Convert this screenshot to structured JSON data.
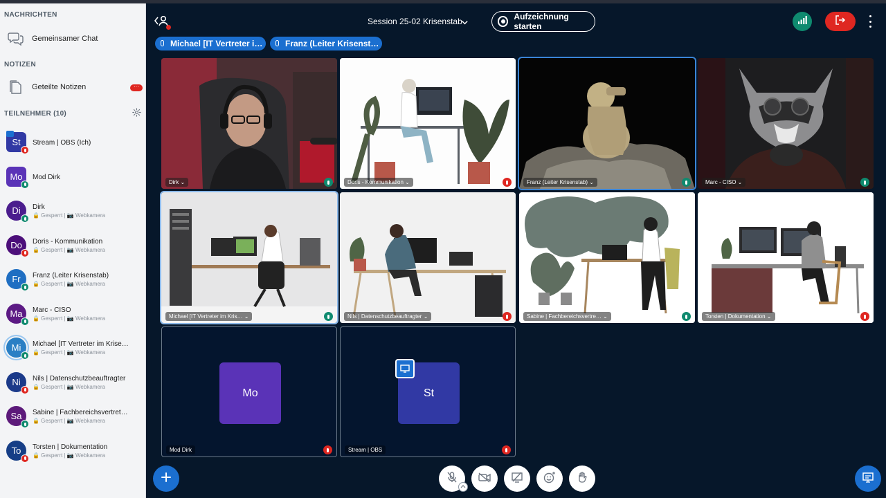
{
  "sidebar": {
    "messages_title": "NACHRICHTEN",
    "chat_label": "Gemeinsamer Chat",
    "notes_title": "NOTIZEN",
    "notes_label": "Geteilte Notizen",
    "notes_badge": "···",
    "participants_title": "TEILNEHMER (10)",
    "participants": [
      {
        "initials": "St",
        "name": "Stream | OBS (Ich)",
        "sub": "",
        "color": "#3139a4",
        "mic": "red"
      },
      {
        "initials": "Mo",
        "name": "Mod Dirk",
        "sub": "",
        "color": "#5a33b7",
        "mic": "green"
      },
      {
        "initials": "Di",
        "name": "Dirk",
        "sub": "🔒 Gesperrt | 📷 Webkamera",
        "color": "#4b1d8e",
        "mic": "green"
      },
      {
        "initials": "Do",
        "name": "Doris - Kommunikation",
        "sub": "🔒 Gesperrt | 📷 Webkamera",
        "color": "#4c0f7a",
        "mic": "red"
      },
      {
        "initials": "Fr",
        "name": "Franz (Leiter Krisenstab)",
        "sub": "🔒 Gesperrt | 📷 Webkamera",
        "color": "#1f6ec2",
        "mic": "green"
      },
      {
        "initials": "Ma",
        "name": "Marc - CISO",
        "sub": "🔒 Gesperrt | 📷 Webkamera",
        "color": "#5c1a84",
        "mic": "green"
      },
      {
        "initials": "Mi",
        "name": "Michael [IT Vertreter im Krise…",
        "sub": "🔒 Gesperrt | 📷 Webkamera",
        "color": "#2a7fc4",
        "mic": "green"
      },
      {
        "initials": "Ni",
        "name": "Nils | Datenschutzbeauftragter",
        "sub": "🔒 Gesperrt | 📷 Webkamera",
        "color": "#1b3a8a",
        "mic": "red"
      },
      {
        "initials": "Sa",
        "name": "Sabine | Fachbereichsvertret…",
        "sub": "🔒 Gesperrt | 📷 Webkamera",
        "color": "#5c1a7a",
        "mic": "green"
      },
      {
        "initials": "To",
        "name": "Torsten | Dokumentation",
        "sub": "🔒 Gesperrt | 📷 Webkamera",
        "color": "#163e86",
        "mic": "red"
      }
    ]
  },
  "header": {
    "session_title": "Session 25-02 Krisenstab",
    "record_label": "Aufzeichnung starten",
    "talkers": [
      "Michael [IT Vertreter i…",
      "Franz (Leiter Krisenst…"
    ]
  },
  "tiles": [
    {
      "name": "Dirk ⌄",
      "mic": "green"
    },
    {
      "name": "Doris - Kommunikation ⌄",
      "mic": "red"
    },
    {
      "name": "Franz (Leiter Krisenstab) ⌄",
      "mic": "green"
    },
    {
      "name": "Marc - CISO ⌄",
      "mic": "green"
    },
    {
      "name": "Michael [IT Vertreter im Kris… ⌄",
      "mic": "green"
    },
    {
      "name": "Nils | Datenschutzbeauftragter ⌄",
      "mic": "red"
    },
    {
      "name": "Sabine | Fachbereichsvertre… ⌄",
      "mic": "green"
    },
    {
      "name": "Torsten | Dokumentation ⌄",
      "mic": "red"
    },
    {
      "name": "Mod Dirk",
      "mic": "red",
      "initials": "Mo",
      "color": "#5a33b7"
    },
    {
      "name": "Stream | OBS",
      "mic": "red",
      "initials": "St",
      "color": "#3139a4"
    }
  ],
  "icons": {
    "chat": "chat-bubbles-icon",
    "notes": "document-icon",
    "settings": "gear-icon",
    "mute": "microphone-muted-icon",
    "camera": "camera-off-icon",
    "screenshare": "screen-share-off-icon",
    "reactions": "emoji-icon",
    "raise_hand": "hand-icon"
  },
  "colors": {
    "accent": "#1b6fd0",
    "danger": "#df2721",
    "success": "#0f8a6f",
    "background": "#06172a"
  }
}
